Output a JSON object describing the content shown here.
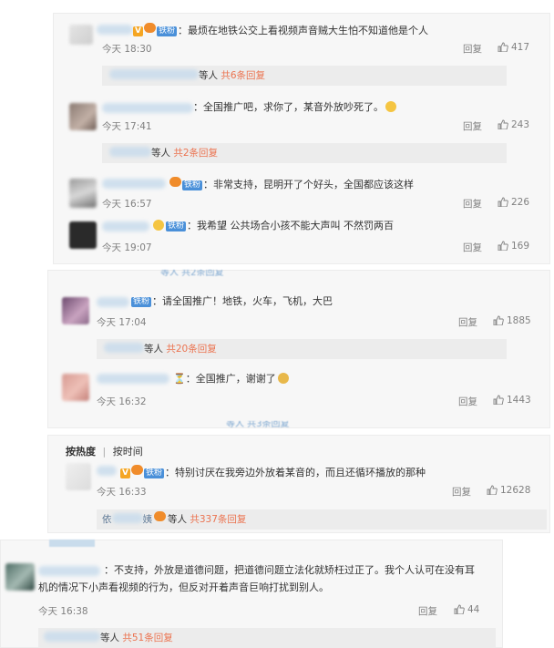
{
  "comments": [
    {
      "text": "：最烦在地铁公交上看视频声音贼大生怕不知道他是个人",
      "time": "今天 18:30",
      "reply": "回复",
      "likes": "417"
    },
    {
      "text": "：全国推广吧，求你了，某音外放吵死了。",
      "time": "今天 17:41",
      "reply": "回复",
      "likes": "243"
    },
    {
      "text": "：非常支持，昆明开了个好头，全国都应该这样",
      "time": "今天 16:57",
      "reply": "回复",
      "likes": "226"
    },
    {
      "text": "：我希望 公共场合小孩不能大声叫  不然罚两百",
      "time": "今天 19:07",
      "reply": "回复",
      "likes": "169"
    },
    {
      "text": "：请全国推广！地铁，火车，飞机，大巴",
      "time": "今天 17:04",
      "reply": "回复",
      "likes": "1885"
    },
    {
      "text": "：全国推广，谢谢了",
      "time": "今天 16:32",
      "reply": "回复",
      "likes": "1443"
    },
    {
      "text": "：特别讨厌在我旁边外放着某音的，而且还循环播放的那种",
      "time": "今天 16:33",
      "reply": "回复",
      "likes": "12628"
    },
    {
      "text1": "：不支持，外放是道德问题，把道德问题立法化就矫枉过正了。我个人认可在没有耳",
      "text2": "机的情况下小声看视频的行为，但反对开着声音巨响打扰到别人。",
      "time": "今天 16:38",
      "reply": "回复",
      "likes": "44"
    }
  ],
  "subreplies": [
    {
      "prefix": "等人 ",
      "count": "共6条回复"
    },
    {
      "prefix": "等人 ",
      "count": "共2条回复"
    },
    {
      "prefix": "等人 ",
      "count": "共20条回复"
    },
    {
      "prefix": "等人 ",
      "count": "共337条回复"
    },
    {
      "prefix": "等人 ",
      "count": "共51条回复"
    }
  ],
  "subreply_name_4": "依",
  "subreply_name_4b": "姨",
  "badges": {
    "fan": "铁粉",
    "vip": "V"
  },
  "tabs": {
    "hot": "按热度",
    "sep": "|",
    "time": "按时间"
  },
  "cutoff": {
    "c1": "等人 共2条回复",
    "c2": "等人 共3条回复"
  },
  "colors": {
    "link": "#eb7350",
    "fan_badge": "#4a90d9",
    "card_bg": "#f7f7f7",
    "sub_bg": "#ececec"
  }
}
